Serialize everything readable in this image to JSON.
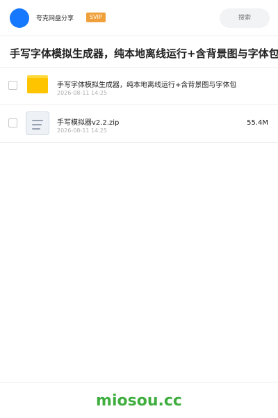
{
  "header": {
    "username": "夸克网盘分享",
    "badge": "SVIP",
    "search_placeholder": "搜索"
  },
  "share": {
    "title": "手写字体模拟生成器，纯本地离线运行+含背景图与字体包"
  },
  "files": [
    {
      "name": "手写字体模拟生成器，纯本地离线运行+含背景图与字体包",
      "date": "2026-08-11 14:25",
      "size": "",
      "icon": "folder-icon"
    },
    {
      "name": "手写模拟器v2.2.zip",
      "date": "2026-08-11 14:25",
      "size": "55.4M",
      "icon": "document-icon"
    }
  ],
  "footer": {
    "watermark": "miosou.cc"
  },
  "colors": {
    "avatar": "#1677ff",
    "badge": "#f0a03a",
    "folder": "#ffc400",
    "watermark": "#3fae3f"
  }
}
